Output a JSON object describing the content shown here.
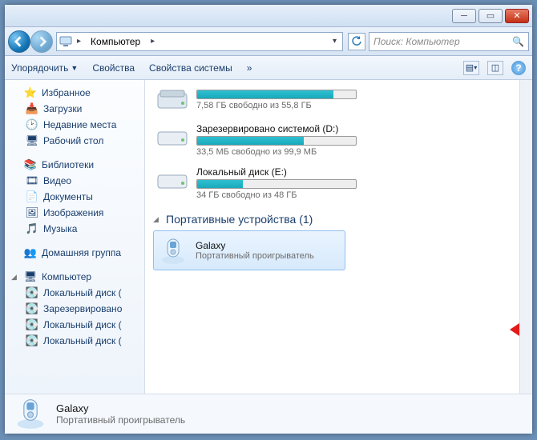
{
  "breadcrumb": {
    "loc": "Компьютер"
  },
  "search": {
    "placeholder": "Поиск: Компьютер"
  },
  "toolbar": {
    "organize": "Упорядочить",
    "properties": "Свойства",
    "sys_props": "Свойства системы",
    "overflow": "»"
  },
  "sidebar": {
    "favorites": {
      "label": "Избранное",
      "items": [
        "Загрузки",
        "Недавние места",
        "Рабочий стол"
      ]
    },
    "libraries": {
      "label": "Библиотеки",
      "items": [
        "Видео",
        "Документы",
        "Изображения",
        "Музыка"
      ]
    },
    "homegroup": {
      "label": "Домашняя группа"
    },
    "computer": {
      "label": "Компьютер",
      "items": [
        "Локальный диск (",
        "Зарезервировано",
        "Локальный диск (",
        "Локальный диск ("
      ]
    }
  },
  "drives": [
    {
      "name": "",
      "stat": "7,58 ГБ свободно из 55,8 ГБ",
      "fill": 86
    },
    {
      "name": "Зарезервировано системой (D:)",
      "stat": "33,5 МБ свободно из 99,9 МБ",
      "fill": 67
    },
    {
      "name": "Локальный диск (E:)",
      "stat": "34 ГБ  свободно из 48 ГБ",
      "fill": 29
    }
  ],
  "portable_section": {
    "label": "Портативные устройства (1)"
  },
  "device": {
    "name": "Galaxy",
    "sub": "Портативный проигрыватель"
  },
  "status": {
    "name": "Galaxy",
    "sub": "Портативный проигрыватель"
  }
}
